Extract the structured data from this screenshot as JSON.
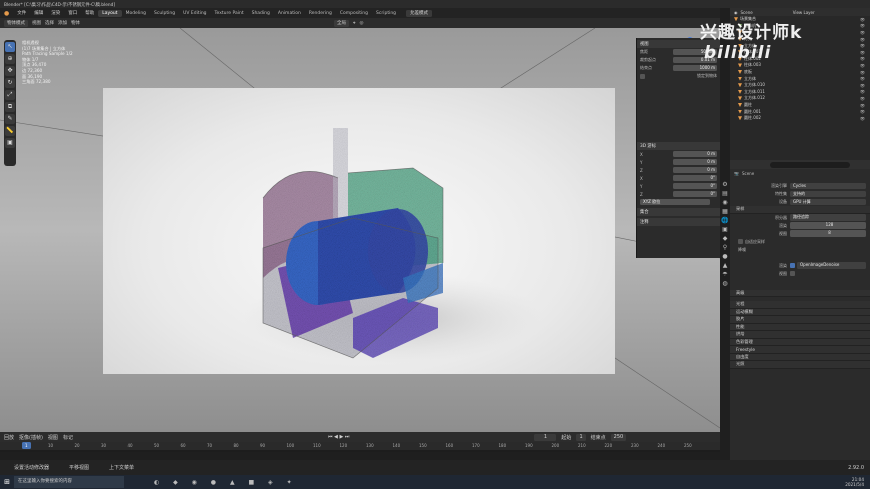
{
  "window": {
    "title": "Blender* [C:\\集习\\作品\\C4D-示\\不锈钢元件-C\\稿.blend]"
  },
  "menu": {
    "items": [
      "文件",
      "编辑",
      "渲染",
      "窗口",
      "帮助"
    ],
    "workspaces": [
      "Layout",
      "Modeling",
      "Sculpting",
      "UV Editing",
      "Texture Paint",
      "Shading",
      "Animation",
      "Rendering",
      "Compositing",
      "Scripting"
    ],
    "active_workspace": "Layout",
    "badge": "允差模式"
  },
  "header": {
    "mode": "物体模式",
    "items": [
      "视图",
      "选择",
      "添加",
      "物体"
    ],
    "transform": "全局"
  },
  "viewport_info": {
    "lines": [
      "相机透视",
      "(1)7 场景集合 | 立方体",
      "Path Tracing Sample 1/2",
      "",
      "物体    1/7",
      "顶点    36,470",
      "边      72,360",
      "面      36,190",
      "三角面  72,380"
    ]
  },
  "npanel": {
    "sections": [
      {
        "title": "视图",
        "rows": [
          [
            "焦距",
            "50 mm"
          ],
          [
            "裁剪起点",
            "0.01 m"
          ],
          [
            "结束点",
            "1000 m"
          ]
        ]
      },
      {
        "title": "3D 游标",
        "rows": [
          [
            "X",
            "0 m"
          ],
          [
            "Y",
            "0 m"
          ],
          [
            "Z",
            "0 m"
          ],
          [
            "X",
            "0°"
          ],
          [
            "Y",
            "0°"
          ],
          [
            "Z",
            "0°"
          ]
        ]
      }
    ],
    "lock_label": "锁定到物体",
    "rotation_mode": "XYZ 欧拉",
    "collections": "集合",
    "annotations": "注释",
    "tabs": [
      "条目",
      "工具",
      "视图"
    ]
  },
  "outliner": {
    "scene": "Scene",
    "view_layer": "View Layer",
    "items": [
      "场景集合",
      "摄像机",
      "平面",
      "灯光",
      "立方体",
      "柱体.001",
      "柱体.002",
      "柱体.003",
      "底板",
      "立方体",
      "立方体.010",
      "立方体.011",
      "立方体.012",
      "圆柱",
      "圆柱.001",
      "圆柱.002"
    ]
  },
  "properties": {
    "scene_name": "Scene",
    "render_engine": {
      "label": "渲染引擎",
      "value": "Cycles"
    },
    "feature_set": {
      "label": "特性集",
      "value": "支持的"
    },
    "device": {
      "label": "设备",
      "value": "GPU 计算"
    },
    "sampling": {
      "title": "采样",
      "integrator_label": "积分器",
      "integrator_value": "路径追踪",
      "render_label": "渲染",
      "render_value": "128",
      "viewport_label": "视图",
      "viewport_value": "8"
    },
    "adaptive": "自适应采样",
    "denoise": "降噪",
    "denoise_render_label": "渲染",
    "denoise_render_value": "OpenImageDenoise",
    "denoise_view_label": "视图",
    "advanced": "高级",
    "sections": [
      "光程",
      "运动模糊",
      "胶片",
      "性能",
      "烘焙",
      "色彩管理",
      "Freestyle",
      "自由度",
      "光照"
    ]
  },
  "timeline": {
    "menus": [
      "回放",
      "抠像(插帧)",
      "视图",
      "标记"
    ],
    "current_frame": "1",
    "start_label": "起始",
    "start": "1",
    "end_label": "结束点",
    "end": "250",
    "ticks": [
      "10",
      "20",
      "30",
      "40",
      "50",
      "60",
      "70",
      "80",
      "90",
      "100",
      "110",
      "120",
      "130",
      "140",
      "150",
      "160",
      "170",
      "180",
      "190",
      "200",
      "210",
      "220",
      "230",
      "240",
      "250"
    ]
  },
  "status": {
    "left": "设置活动修改器",
    "mid": "平移视图",
    "right": "上下文菜单",
    "version": "2.92.0"
  },
  "taskbar": {
    "search": "在这里输入你要搜索的内容",
    "time": "21:04",
    "date": "2021/5/4"
  },
  "watermark": "兴趣设计师k",
  "watermark_logo": "bilibili",
  "colors": {
    "accent": "#4772b3",
    "orange": "#e59a4b",
    "panel": "#2b2b2b"
  }
}
